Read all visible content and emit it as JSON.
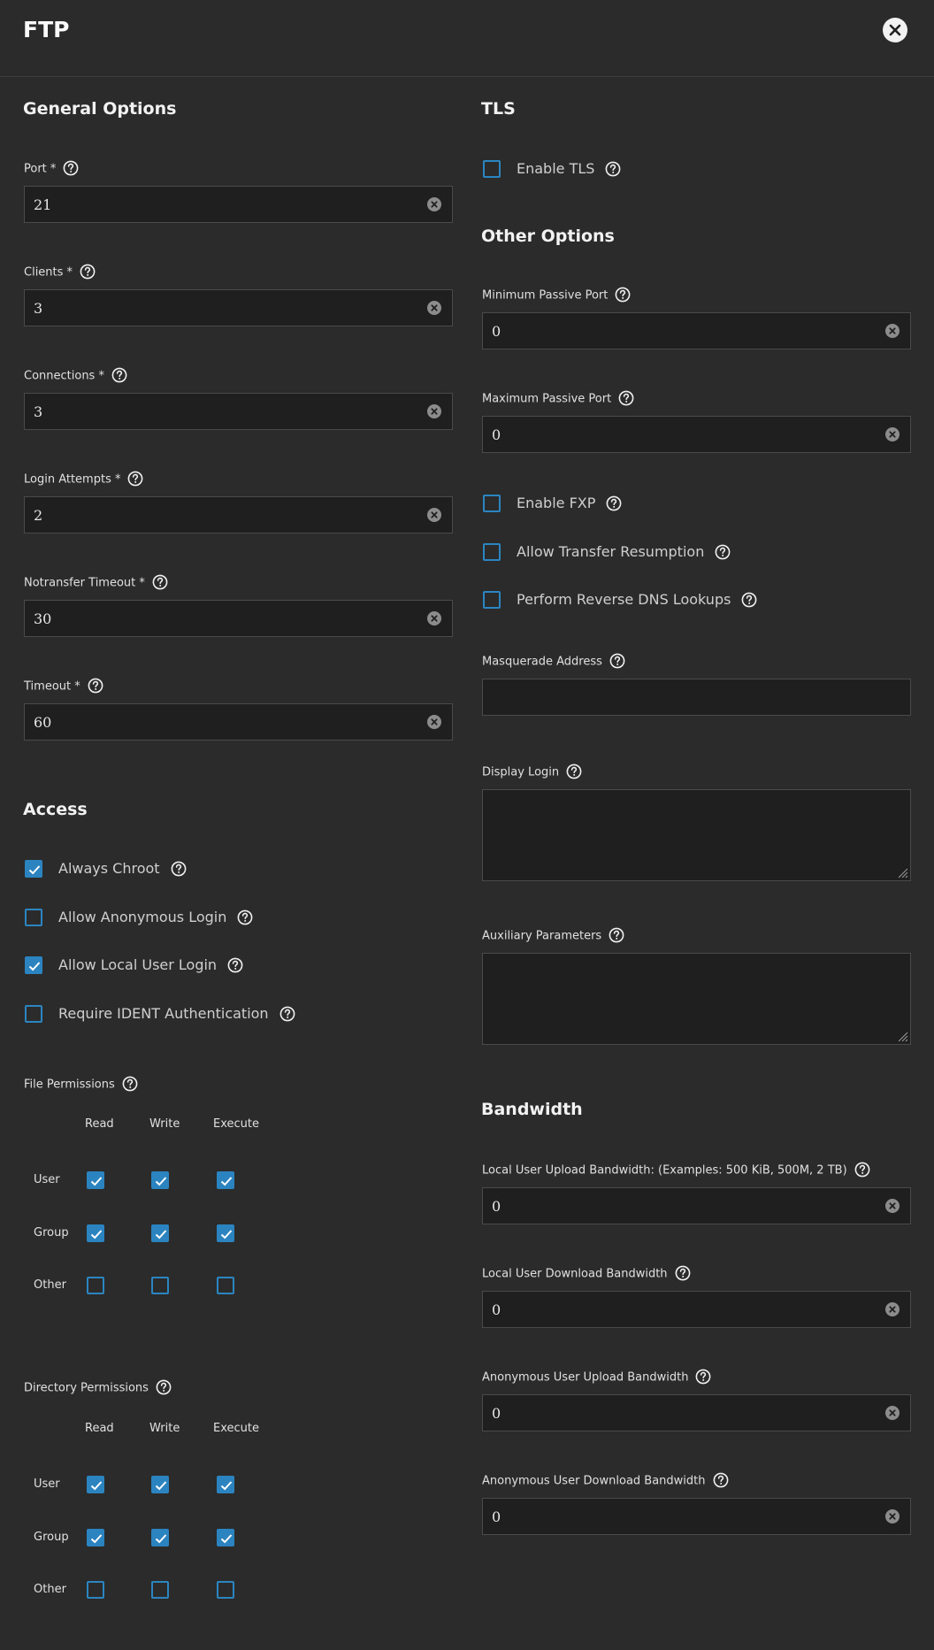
{
  "header": {
    "title": "FTP"
  },
  "left": {
    "general_title": "General Options",
    "fields": [
      {
        "label": "Port *",
        "value": "21"
      },
      {
        "label": "Clients *",
        "value": "3"
      },
      {
        "label": "Connections *",
        "value": "3"
      },
      {
        "label": "Login Attempts *",
        "value": "2"
      },
      {
        "label": "Notransfer Timeout *",
        "value": "30"
      },
      {
        "label": "Timeout *",
        "value": "60"
      }
    ],
    "access_title": "Access",
    "access_options": [
      {
        "label": "Always Chroot",
        "checked": true
      },
      {
        "label": "Allow Anonymous Login",
        "checked": false
      },
      {
        "label": "Allow Local User Login",
        "checked": true
      },
      {
        "label": "Require IDENT Authentication",
        "checked": false
      }
    ],
    "file_permissions": {
      "label": "File Permissions",
      "columns": [
        "Read",
        "Write",
        "Execute"
      ],
      "rows": [
        {
          "label": "User",
          "values": [
            true,
            true,
            true
          ]
        },
        {
          "label": "Group",
          "values": [
            true,
            true,
            true
          ]
        },
        {
          "label": "Other",
          "values": [
            false,
            false,
            false
          ]
        }
      ]
    },
    "directory_permissions": {
      "label": "Directory Permissions",
      "columns": [
        "Read",
        "Write",
        "Execute"
      ],
      "rows": [
        {
          "label": "User",
          "values": [
            true,
            true,
            true
          ]
        },
        {
          "label": "Group",
          "values": [
            true,
            true,
            true
          ]
        },
        {
          "label": "Other",
          "values": [
            false,
            false,
            false
          ]
        }
      ]
    }
  },
  "right": {
    "tls_title": "TLS",
    "enable_tls": {
      "label": "Enable TLS",
      "checked": false
    },
    "other_title": "Other Options",
    "min_passive_port": {
      "label": "Minimum Passive Port",
      "value": "0"
    },
    "max_passive_port": {
      "label": "Maximum Passive Port",
      "value": "0"
    },
    "other_options": [
      {
        "label": "Enable FXP",
        "checked": false
      },
      {
        "label": "Allow Transfer Resumption",
        "checked": false
      },
      {
        "label": "Perform Reverse DNS Lookups",
        "checked": false
      }
    ],
    "masquerade_address": {
      "label": "Masquerade Address",
      "value": ""
    },
    "display_login": {
      "label": "Display Login",
      "value": ""
    },
    "auxiliary_parameters": {
      "label": "Auxiliary Parameters",
      "value": ""
    },
    "bandwidth_title": "Bandwidth",
    "bandwidth_fields": [
      {
        "label": "Local User Upload Bandwidth: (Examples: 500 KiB, 500M, 2 TB)",
        "value": "0"
      },
      {
        "label": "Local User Download Bandwidth",
        "value": "0"
      },
      {
        "label": "Anonymous User Upload Bandwidth",
        "value": "0"
      },
      {
        "label": "Anonymous User Download Bandwidth",
        "value": "0"
      }
    ]
  },
  "colors": {
    "background": "#2b2b2b",
    "input_bg": "#1f1f1f",
    "accent": "#2b83c0"
  },
  "icons": {
    "close": "close-icon",
    "help": "help-icon",
    "clear": "clear-icon",
    "check": "check-icon"
  }
}
